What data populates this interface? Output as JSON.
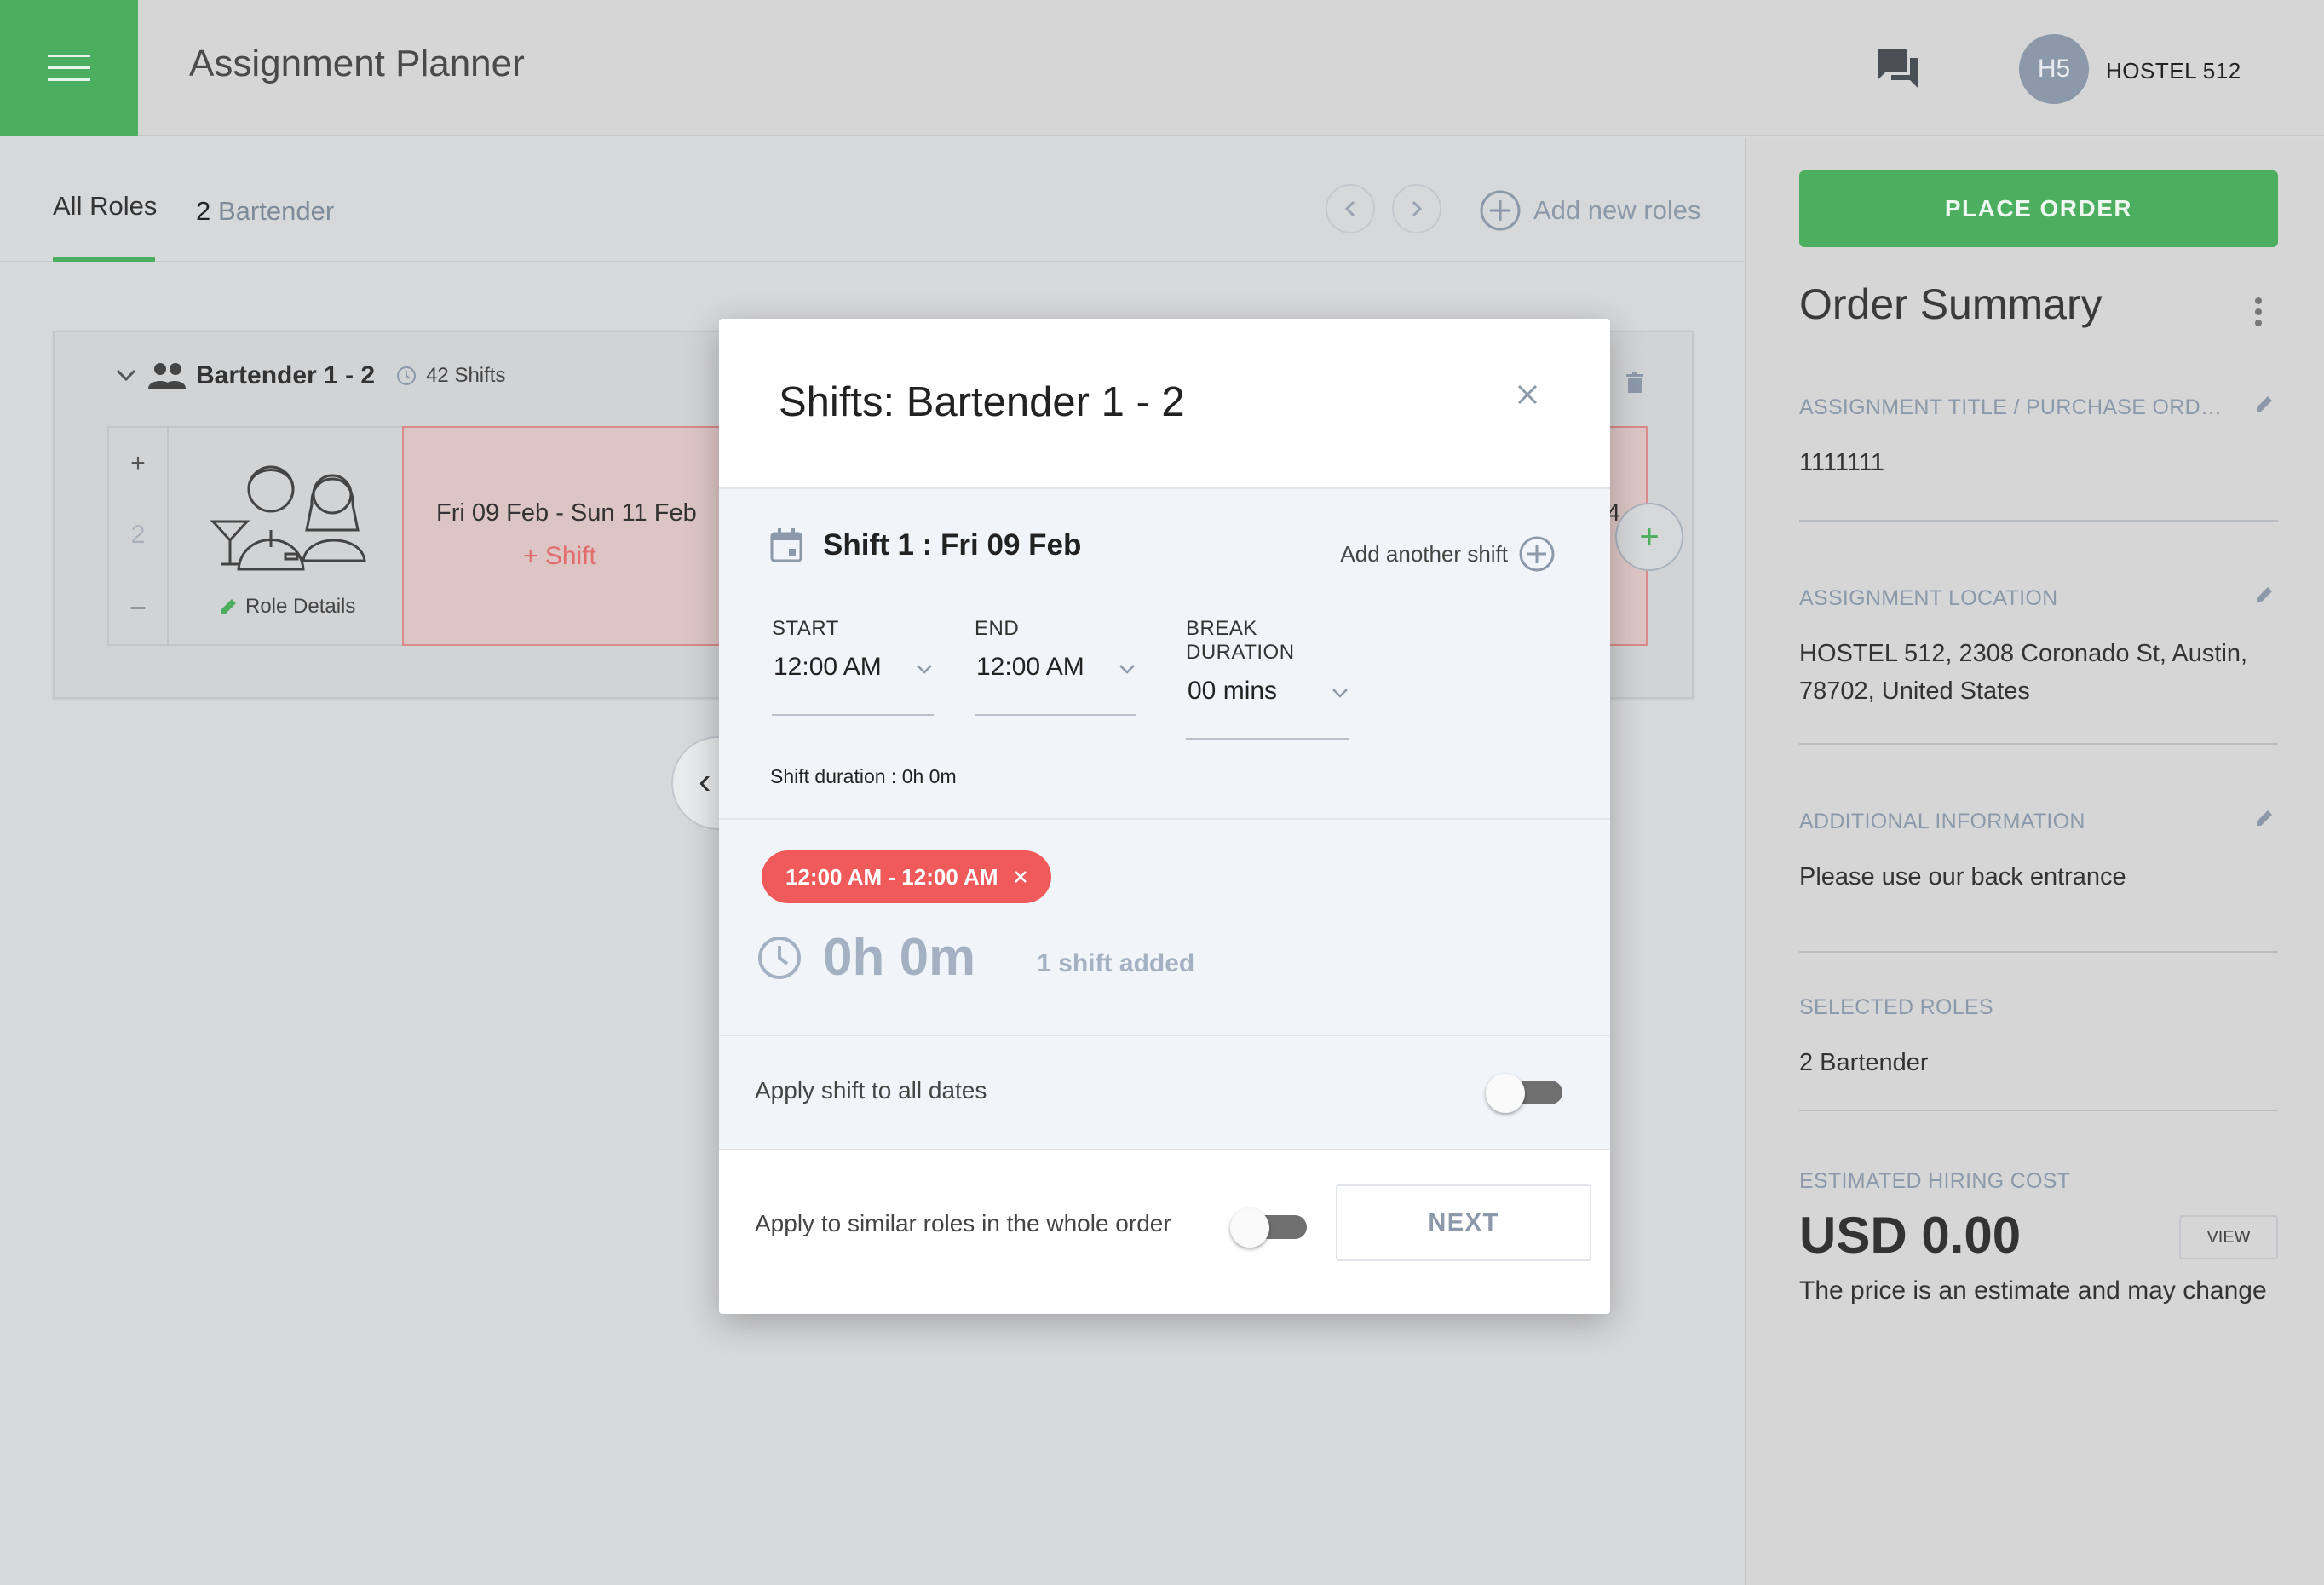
{
  "app": {
    "title": "Assignment Planner"
  },
  "account": {
    "initials": "H5",
    "name": "HOSTEL 512"
  },
  "tabs": {
    "all_roles": "All Roles",
    "role_count": "2",
    "role_name": "Bartender",
    "add_new_roles": "Add new roles"
  },
  "role_card": {
    "title": "Bartender 1 - 2",
    "shifts": "42 Shifts",
    "quantity": "2",
    "role_details": "Role Details",
    "date_range": "Fri 09 Feb - Sun 11 Feb",
    "add_shift": "+ Shift",
    "next_date_partial": "4"
  },
  "order_summary": {
    "place_order": "PLACE ORDER",
    "title": "Order Summary",
    "sections": [
      {
        "label": "ASSIGNMENT TITLE / PURCHASE ORDE...",
        "value": "1111111"
      },
      {
        "label": "ASSIGNMENT LOCATION",
        "value": "HOSTEL 512, 2308 Coronado St, Austin, 78702, United States"
      },
      {
        "label": "ADDITIONAL INFORMATION",
        "value": "Please use our back entrance"
      },
      {
        "label": "SELECTED ROLES",
        "value": "2 Bartender"
      }
    ],
    "cost_label": "ESTIMATED HIRING COST",
    "cost_value": "USD 0.00",
    "view": "VIEW",
    "cost_note": "The price is an estimate and may change"
  },
  "modal": {
    "title": "Shifts: Bartender 1 - 2",
    "shift_title": "Shift 1 : Fri 09 Feb",
    "add_another_shift": "Add another shift",
    "start_label": "START",
    "start_value": "12:00 AM",
    "end_label": "END",
    "end_value": "12:00 AM",
    "break_label": "BREAK DURATION",
    "break_value": "00 mins",
    "shift_duration": "Shift duration : 0h 0m",
    "chip": "12:00 AM - 12:00 AM",
    "total": "0h 0m",
    "shifts_added": "1 shift added",
    "apply_all_dates": "Apply shift to all dates",
    "apply_all_dates_on": false,
    "apply_similar_roles": "Apply to similar roles in the whole order",
    "apply_similar_roles_on": false,
    "next": "NEXT"
  },
  "colors": {
    "brand_green": "#4caf5f",
    "chip_red": "#f05a5a",
    "muted_blue": "#8c99ab"
  }
}
